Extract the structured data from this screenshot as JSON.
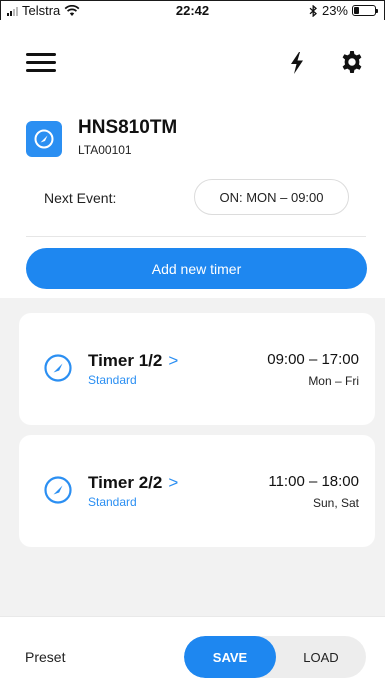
{
  "status_bar": {
    "carrier": "Telstra",
    "time": "22:42",
    "battery_percent": "23%",
    "battery_level": 0.23,
    "icons": [
      "signal-icon",
      "wifi-icon",
      "bluetooth-icon",
      "battery-icon"
    ]
  },
  "header": {
    "icons": [
      "menu-icon",
      "lightning-bolt-icon",
      "gear-icon"
    ]
  },
  "device": {
    "name": "HNS810TM",
    "id": "LTA00101",
    "icon": "timer-gauge-icon",
    "next_event_label": "Next Event:",
    "next_event_value": "ON: MON – 09:00"
  },
  "add_timer_label": "Add new timer",
  "timers": [
    {
      "name": "Timer 1/2",
      "chevron": ">",
      "type": "Standard",
      "time_range": "09:00 – 17:00",
      "days": "Mon – Fri"
    },
    {
      "name": "Timer 2/2",
      "chevron": ">",
      "type": "Standard",
      "time_range": "11:00 – 18:00",
      "days": "Sun, Sat"
    }
  ],
  "bottom_bar": {
    "preset_label": "Preset",
    "save_label": "SAVE",
    "load_label": "LOAD"
  },
  "colors": {
    "accent": "#1e87f0",
    "background_grey": "#f2f2f2",
    "card": "#ffffff"
  }
}
